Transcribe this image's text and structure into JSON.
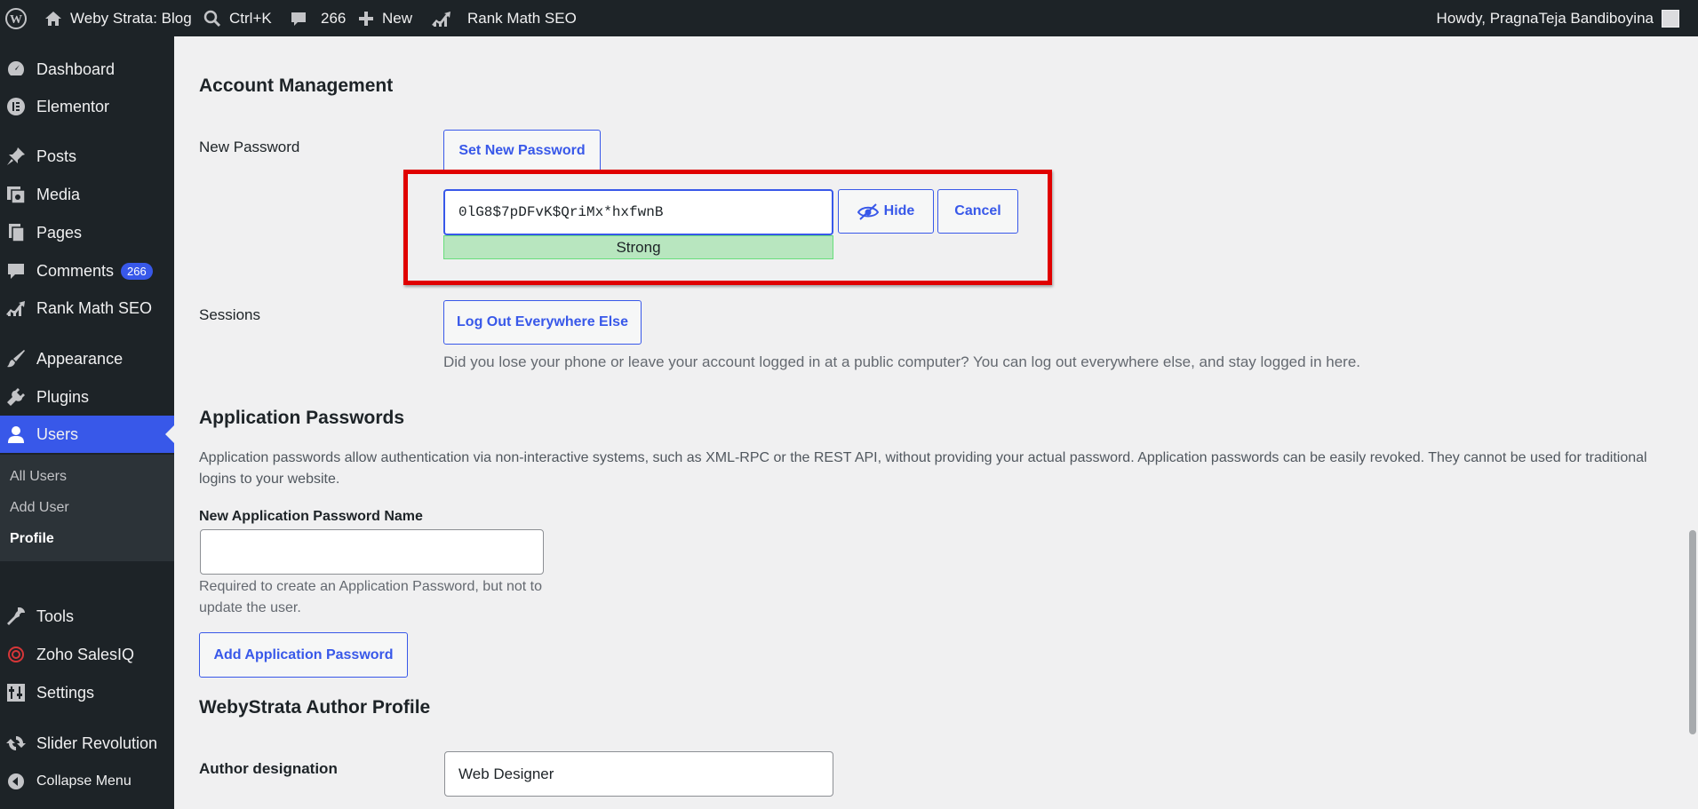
{
  "adminbar": {
    "site_name": "Weby Strata: Blog",
    "search_shortcut": "Ctrl+K",
    "comments_count": "266",
    "new_label": "New",
    "rankmath_label": "Rank Math SEO",
    "howdy": "Howdy, PragnaTeja Bandiboyina"
  },
  "sidebar": {
    "items": [
      {
        "label": "Dashboard",
        "icon": "dashboard-icon"
      },
      {
        "label": "Elementor",
        "icon": "elementor-icon"
      },
      {
        "label": "Posts",
        "icon": "pin-icon"
      },
      {
        "label": "Media",
        "icon": "media-icon"
      },
      {
        "label": "Pages",
        "icon": "pages-icon"
      },
      {
        "label": "Comments",
        "icon": "comment-icon",
        "badge": "266"
      },
      {
        "label": "Rank Math SEO",
        "icon": "rankmath-icon"
      },
      {
        "label": "Appearance",
        "icon": "brush-icon"
      },
      {
        "label": "Plugins",
        "icon": "plug-icon"
      },
      {
        "label": "Users",
        "icon": "user-icon"
      },
      {
        "label": "Tools",
        "icon": "wrench-icon"
      },
      {
        "label": "Zoho SalesIQ",
        "icon": "zoho-icon"
      },
      {
        "label": "Settings",
        "icon": "settings-icon"
      },
      {
        "label": "Slider Revolution",
        "icon": "refresh-icon"
      },
      {
        "label": "Collapse Menu",
        "icon": "collapse-icon"
      }
    ],
    "users_submenu": [
      "All Users",
      "Add User",
      "Profile"
    ]
  },
  "account": {
    "heading": "Account Management",
    "new_password_label": "New Password",
    "set_new_password_button": "Set New Password",
    "password_value": "0lG8$7pDFvK$QriMx*hxfwnB",
    "strength": "Strong",
    "hide_button": "Hide",
    "cancel_button": "Cancel",
    "sessions_label": "Sessions",
    "logout_button": "Log Out Everywhere Else",
    "logout_description": "Did you lose your phone or leave your account logged in at a public computer? You can log out everywhere else, and stay logged in here."
  },
  "app_passwords": {
    "heading": "Application Passwords",
    "description": "Application passwords allow authentication via non-interactive systems, such as XML-RPC or the REST API, without providing your actual password. Application passwords can be easily revoked. They cannot be used for traditional logins to your website.",
    "name_label": "New Application Password Name",
    "name_value": "",
    "help": "Required to create an Application Password, but not to update the user.",
    "add_button": "Add Application Password"
  },
  "author_profile": {
    "heading": "WebyStrata Author Profile",
    "designation_label": "Author designation",
    "designation_value": "Web Designer"
  },
  "colors": {
    "accent": "#3858e9",
    "highlight_border": "#e00000",
    "strong_meter": "#b8e6bf"
  }
}
